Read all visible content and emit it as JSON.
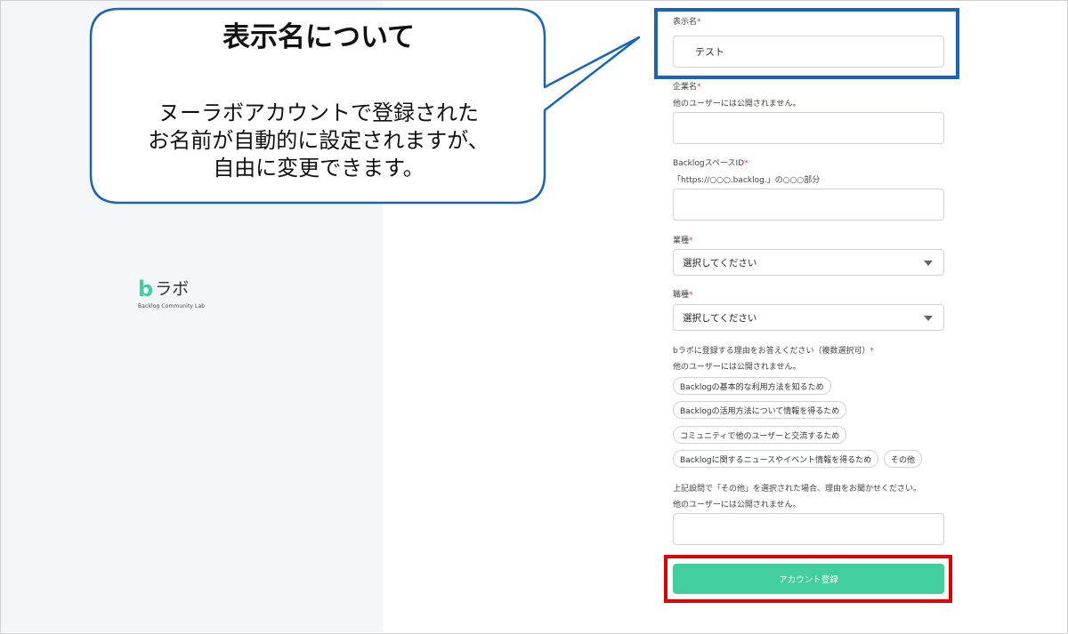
{
  "callout": {
    "title": "表示名について",
    "body_lines": [
      "ヌーラボアカウントで登録された",
      "お名前が自動的に設定されますが、",
      "自由に変更できます。"
    ]
  },
  "logo": {
    "mark": "b",
    "text": "ラボ",
    "subtitle": "Backlog Community Lab"
  },
  "form": {
    "required_mark": "*",
    "display_name": {
      "label": "表示名",
      "value": "テスト"
    },
    "company": {
      "label": "企業名",
      "hint": "他のユーザーには公開されません。",
      "value": ""
    },
    "space_id": {
      "label": "BacklogスペースID",
      "hint": "「https://○○○.backlog.」の○○○部分",
      "value": ""
    },
    "industry": {
      "label": "業種",
      "selected": "選択してください"
    },
    "job": {
      "label": "職種",
      "selected": "選択してください"
    },
    "reasons": {
      "label": "bラボに登録する理由をお答えください（複数選択可）",
      "hint": "他のユーザーには公開されません。",
      "options": [
        "Backlogの基本的な利用方法を知るため",
        "Backlogの活用方法について情報を得るため",
        "コミュニティで他のユーザーと交流するため",
        "Backlogに関するニュースやイベント情報を得るため",
        "その他"
      ]
    },
    "other_reason": {
      "label": "上記設問で「その他」を選択された場合、理由をお聞かせください。",
      "hint": "他のユーザーには公開されません。",
      "value": ""
    },
    "submit_label": "アカウント登録"
  },
  "colors": {
    "accent": "#42ce9f",
    "highlight_blue": "#1865b5",
    "highlight_red": "#e10000",
    "required": "#e0335c"
  }
}
